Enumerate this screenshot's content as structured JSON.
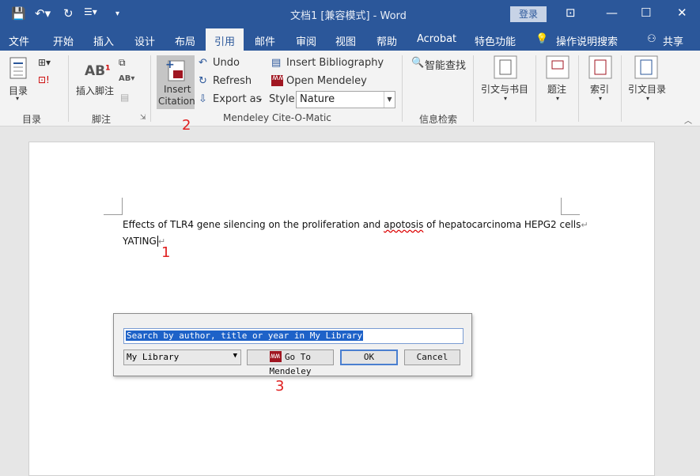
{
  "titlebar": {
    "title": "文档1 [兼容模式] - Word",
    "login": "登录"
  },
  "menu": {
    "tabs": [
      "文件",
      "开始",
      "插入",
      "设计",
      "布局",
      "引用",
      "邮件",
      "审阅",
      "视图",
      "帮助",
      "Acrobat",
      "特色功能"
    ],
    "active_tab": "引用",
    "tell_me": "操作说明搜索",
    "share": "共享"
  },
  "ribbon": {
    "toc": {
      "button": "目录",
      "group": "目录"
    },
    "footnotes": {
      "insert": "插入脚注",
      "group": "脚注"
    },
    "mendeley": {
      "insert_citation_1": "Insert",
      "insert_citation_2": "Citation",
      "undo": "Undo",
      "refresh": "Refresh",
      "export_as": "Export as",
      "insert_bibliography": "Insert Bibliography",
      "open_mendeley": "Open Mendeley",
      "style_label": "Style:",
      "style_value": "Nature",
      "group": "Mendeley Cite-O-Matic"
    },
    "info": {
      "smart_lookup": "智能查找",
      "group": "信息检索"
    },
    "citations": {
      "button": "引文与书目"
    },
    "captions": {
      "button": "题注"
    },
    "index": {
      "button": "索引"
    },
    "toa": {
      "button": "引文目录"
    }
  },
  "document": {
    "line1_a": "Effects of TLR4 gene silencing on the proliferation and ",
    "line1_misspelled": "apotosis",
    "line1_b": " of hepatocarcinoma HEPG2 cells",
    "line2": "YATING"
  },
  "annotations": {
    "mark1": "1",
    "mark2": "2",
    "mark3": "3"
  },
  "dialog": {
    "search_placeholder": "Search by author, title or year in My Library",
    "library": "My Library",
    "go_to_mendeley": "Go To Mendeley",
    "ok": "OK",
    "cancel": "Cancel"
  }
}
